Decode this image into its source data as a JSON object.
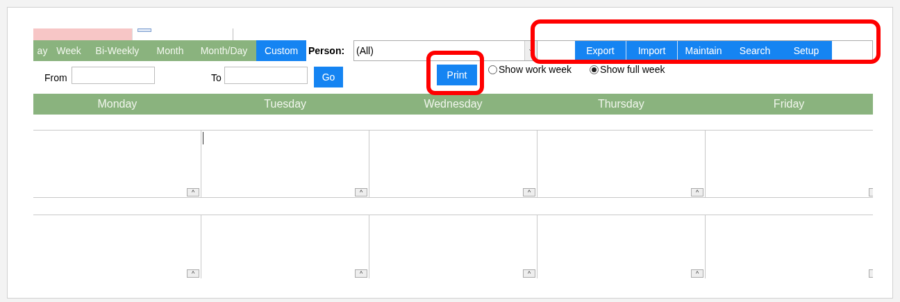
{
  "view_tabs": [
    {
      "label": "ay",
      "selected": false
    },
    {
      "label": "Week",
      "selected": false
    },
    {
      "label": "Bi-Weekly",
      "selected": false
    },
    {
      "label": "Month",
      "selected": false
    },
    {
      "label": "Month/Day",
      "selected": false
    },
    {
      "label": "Custom",
      "selected": true
    }
  ],
  "person": {
    "label": "Person:",
    "value": "(All)"
  },
  "actions": [
    "Export",
    "Import",
    "Maintain",
    "Search",
    "Setup"
  ],
  "range": {
    "from_label": "From",
    "to_label": "To",
    "go": "Go"
  },
  "print": "Print",
  "week_options": [
    {
      "label": "Show work week",
      "selected": false
    },
    {
      "label": "Show full week",
      "selected": true
    }
  ],
  "days": [
    "Monday",
    "Tuesday",
    "Wednesday",
    "Thursday",
    "Friday"
  ],
  "weeks": [
    {
      "cells": [
        {
          "button": "^"
        },
        {
          "button": "^"
        },
        {
          "button": "^"
        },
        {
          "button": "^"
        },
        {}
      ]
    },
    {
      "cells": [
        {
          "button": "^"
        },
        {
          "button": "^"
        },
        {
          "button": "^"
        },
        {
          "button": "^"
        },
        {}
      ]
    }
  ]
}
